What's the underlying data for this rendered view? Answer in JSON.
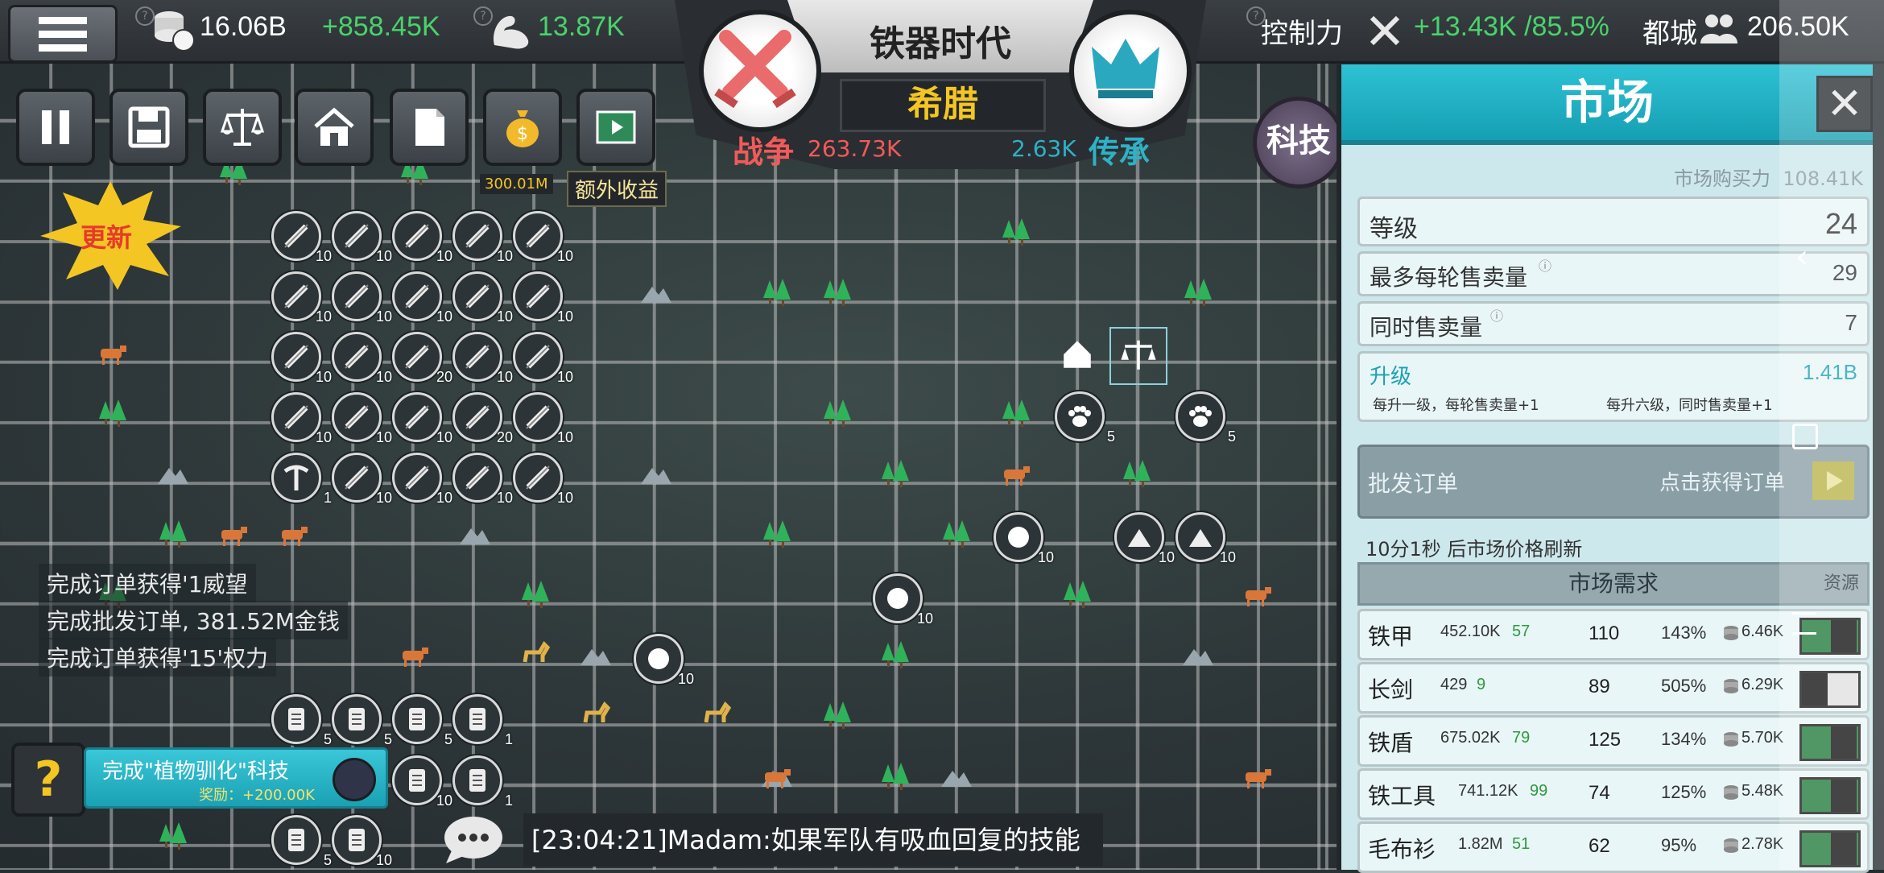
{
  "top_bar": {
    "money": "16.06B",
    "money_income": "+858.45K",
    "strength": "13.87K",
    "control_label": "控制力",
    "control_value": "+13.43K /85.5%",
    "capital_label": "都城",
    "capital_value": "206.50K"
  },
  "banner": {
    "era": "铁器时代",
    "civilization": "希腊",
    "war_label": "战争",
    "war_value": "263.73K",
    "heritage_label": "传承",
    "heritage_value": "2.63K"
  },
  "toolbar": {
    "extra_income_amount": "300.01M",
    "extra_income_label": "额外收益"
  },
  "tech_button": "科技",
  "update_badge": "更新",
  "logs": [
    "完成订单获得'1威望",
    "完成批发订单, 381.52M金钱",
    "完成订单获得'15'权力"
  ],
  "quest": {
    "title": "完成\"植物驯化\"科技",
    "reward": "奖励：+200.00K"
  },
  "chat": "[23:04:21]Madam:如果军队有吸血回复的技能",
  "market": {
    "title": "市场",
    "purchasing_power_label": "市场购买力",
    "purchasing_power": "108.41K",
    "level_label": "等级",
    "level": "24",
    "max_sell_label": "最多每轮售卖量",
    "max_sell": "29",
    "simul_sell_label": "同时售卖量",
    "simul_sell": "7",
    "upgrade_label": "升级",
    "upgrade_cost": "1.41B",
    "upgrade_note_1": "每升一级，每轮售卖量+1",
    "upgrade_note_2": "每升六级，同时售卖量+1",
    "wholesale_label": "批发订单",
    "wholesale_action": "点击获得订单",
    "refresh_text": "10分1秒 后市场价格刷新",
    "demand_header": "市场需求",
    "resource_label": "资源",
    "demand": [
      {
        "name": "铁甲",
        "stock": "452.10K",
        "rate": "57",
        "qty": "110",
        "pct": "143%",
        "price": "6.46K",
        "on": true
      },
      {
        "name": "长剑",
        "stock": "429",
        "rate": "9",
        "qty": "89",
        "pct": "505%",
        "price": "6.29K",
        "on": false
      },
      {
        "name": "铁盾",
        "stock": "675.02K",
        "rate": "79",
        "qty": "125",
        "pct": "134%",
        "price": "5.70K",
        "on": true
      },
      {
        "name": "铁工具",
        "stock": "741.12K",
        "rate": "99",
        "qty": "74",
        "pct": "125%",
        "price": "5.48K",
        "on": true
      },
      {
        "name": "毛布衫",
        "stock": "1.82M",
        "rate": "51",
        "qty": "62",
        "pct": "95%",
        "price": "2.78K",
        "on": true
      }
    ]
  },
  "colors": {
    "accent_teal": "#1fb0c4",
    "income_green": "#49d36b",
    "war_red": "#f25a5a",
    "civ_gold": "#f3c623"
  }
}
